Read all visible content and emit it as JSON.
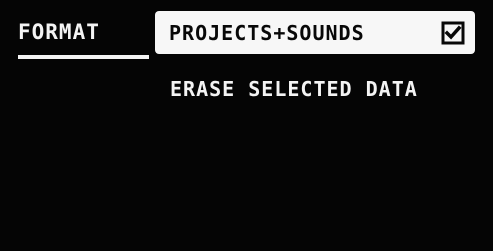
{
  "header": {
    "title": "FORMAT"
  },
  "selector": {
    "label": "PROJECTS+SOUNDS",
    "checked": true,
    "icon": "checkbox-checked-icon"
  },
  "body": {
    "description": "ERASE SELECTED DATA"
  },
  "colors": {
    "background": "#050505",
    "foreground": "#f4f4f4",
    "selected_background": "#f7f7f7",
    "selected_text": "#080808"
  }
}
